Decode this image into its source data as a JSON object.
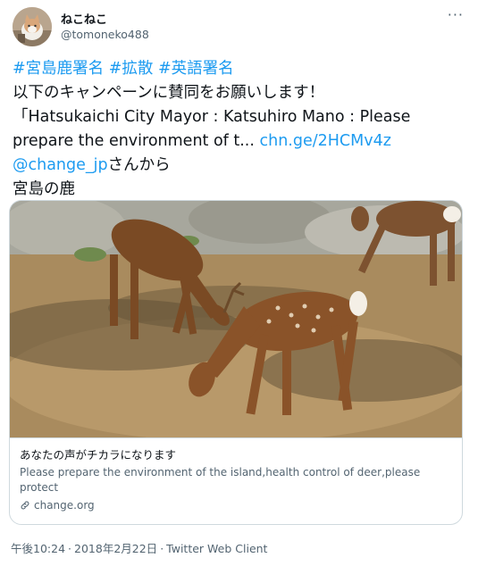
{
  "user": {
    "display_name": "ねこねこ",
    "handle": "@tomoneko488"
  },
  "tweet": {
    "hashtags": [
      "#宮島鹿署名",
      "#拡散",
      "#英語署名"
    ],
    "line2": "以下のキャンペーンに賛同をお願いします！",
    "line3": "「Hatsukaichi City Mayor : Katsuhiro Mano : Please",
    "line4_text": "prepare the environment of t... ",
    "link_text": "chn.ge/2HCMv4z",
    "mention": "@change_jp",
    "mention_suffix": "さんから",
    "line6": "宮島の鹿"
  },
  "card": {
    "title": "あなたの声がチカラになります",
    "description": "Please prepare the environment of the island,health control of deer,please protect",
    "domain": "change.org",
    "image_icon": "deer-photo"
  },
  "meta": {
    "time": "午後10:24",
    "date": "2018年2月22日",
    "client": "Twitter Web Client"
  },
  "colors": {
    "link": "#1d9bf0",
    "secondary": "#536471",
    "border": "#cfd9de"
  }
}
